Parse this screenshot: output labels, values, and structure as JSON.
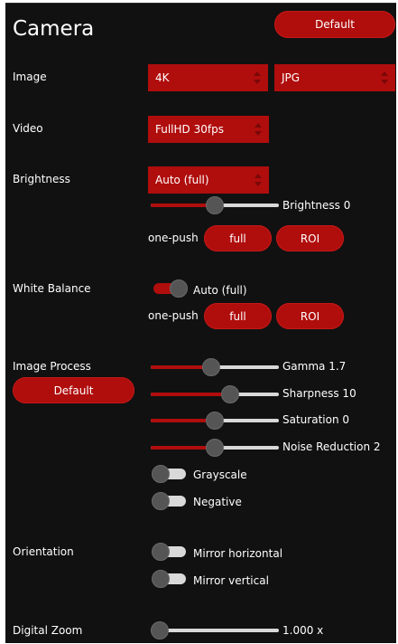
{
  "title": "Camera",
  "header": {
    "default_label": "Default"
  },
  "image": {
    "label": "Image",
    "resolution": "4K",
    "format": "JPG"
  },
  "video": {
    "label": "Video",
    "mode": "FullHD 30fps"
  },
  "brightness": {
    "label": "Brightness",
    "mode": "Auto (full)",
    "slider_label": "Brightness 0",
    "level": 0.5,
    "one_push_label": "one-push",
    "full_label": "full",
    "roi_label": "ROI"
  },
  "white_balance": {
    "label": "White Balance",
    "toggle_label": "Auto (full)",
    "toggle_on": true,
    "one_push_label": "one-push",
    "full_label": "full",
    "roi_label": "ROI"
  },
  "image_process": {
    "label": "Image Process",
    "default_label": "Default",
    "sliders": [
      {
        "label": "Gamma 1.7",
        "level": 0.47
      },
      {
        "label": "Sharpness 10",
        "level": 0.64
      },
      {
        "label": "Saturation 0",
        "level": 0.5
      },
      {
        "label": "Noise Reduction 2",
        "level": 0.5
      }
    ],
    "grayscale_label": "Grayscale",
    "grayscale_on": false,
    "negative_label": "Negative",
    "negative_on": false
  },
  "orientation": {
    "label": "Orientation",
    "mirror_h_label": "Mirror horizontal",
    "mirror_h_on": false,
    "mirror_v_label": "Mirror vertical",
    "mirror_v_on": false
  },
  "digital_zoom": {
    "label": "Digital Zoom",
    "value_label": "1.000 x",
    "level": 0.0
  },
  "colors": {
    "accent": "#b00d0d",
    "background": "#111111",
    "track": "#d9d9d9",
    "knob": "#555555"
  }
}
